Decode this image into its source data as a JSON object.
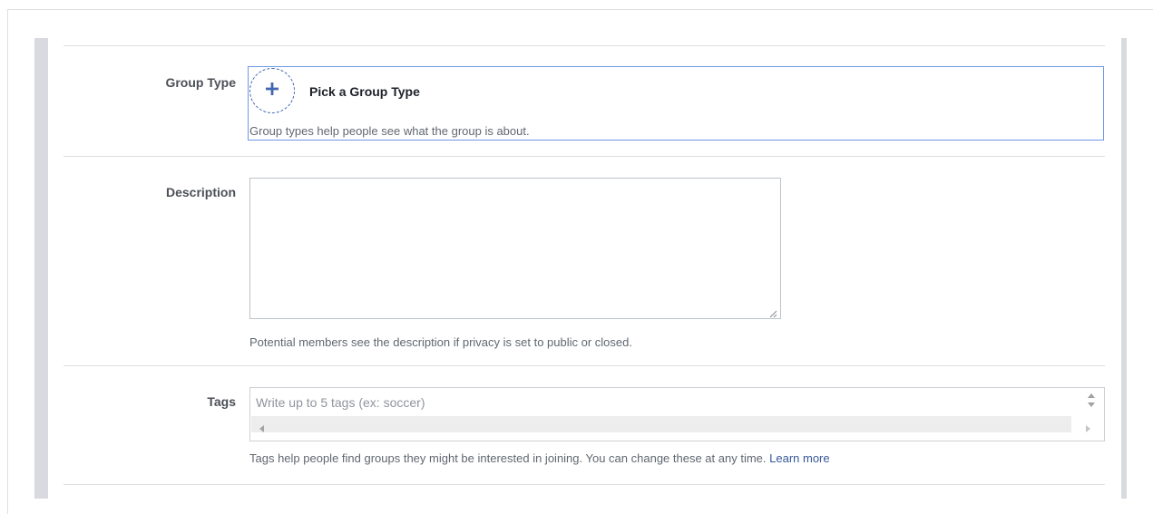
{
  "group_type": {
    "label": "Group Type",
    "button_label": "Pick a Group Type",
    "help": "Group types help people see what the group is about."
  },
  "description": {
    "label": "Description",
    "value": "",
    "help": "Potential members see the description if privacy is set to public or closed."
  },
  "tags": {
    "label": "Tags",
    "placeholder": "Write up to 5 tags (ex: soccer)",
    "help": "Tags help people find groups they might be interested in joining. You can change these at any time.",
    "learn_more": "Learn more"
  },
  "colors": {
    "accent": "#4267b2",
    "focus_border": "#6f97e6",
    "link": "#385898"
  },
  "icons": {
    "plus": "plus-icon",
    "resize": "resize-grip-icon"
  }
}
